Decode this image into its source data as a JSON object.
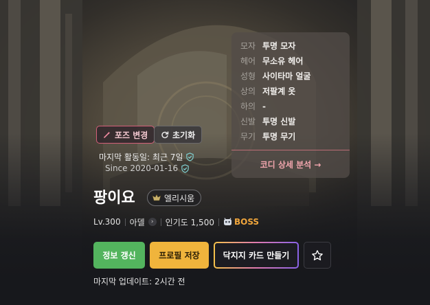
{
  "coordi": {
    "items": [
      {
        "slot": "모자",
        "value": "투명 모자"
      },
      {
        "slot": "헤어",
        "value": "무소유 헤어"
      },
      {
        "slot": "성형",
        "value": "사이타마 얼굴"
      },
      {
        "slot": "상의",
        "value": "저팔계 옷"
      },
      {
        "slot": "하의",
        "value": "-"
      },
      {
        "slot": "신발",
        "value": "투명 신발"
      },
      {
        "slot": "무기",
        "value": "투명 무기"
      }
    ],
    "detail_link": "코디 상세 분석 →"
  },
  "pose_button": "포즈 변경",
  "reset_button": "초기화",
  "activity": {
    "last_active": "마지막 활동일: 최근 7일",
    "since": "Since 2020-01-16"
  },
  "character": {
    "name": "팡이요",
    "guild": "엘리시움",
    "level": "Lv.300",
    "job": "아델",
    "popularity": "인기도 1,500",
    "boss_badge": "BOSS"
  },
  "buttons": {
    "refresh": "정보 갱신",
    "save_profile": "프로필 저장",
    "make_card": "닥지지 카드 만들기"
  },
  "last_update": "마지막 업데이트: 2시간 전",
  "colors": {
    "refresh_green": "#53b45e",
    "save_orange": "#f0b43c",
    "boss_orange": "#f1a63c",
    "pose_pink": "#d5607a",
    "check_teal": "#7fd0d0"
  },
  "icons": {
    "pose": "pose-edit-icon",
    "reset": "refresh-icon",
    "verified": "verified-check-icon",
    "guild": "guild-emblem-icon",
    "boss": "boss-icon",
    "favorite": "star-icon"
  }
}
